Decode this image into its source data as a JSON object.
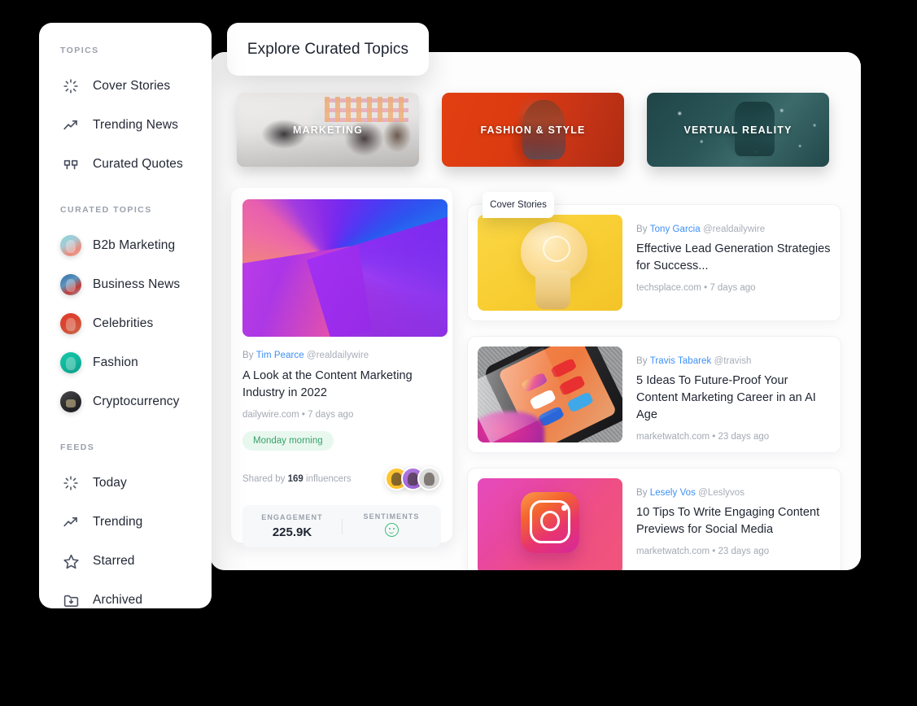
{
  "header": {
    "title": "Explore Curated Topics"
  },
  "sidebar": {
    "sections": [
      {
        "label": "TOPICS",
        "items": [
          {
            "label": "Cover Stories",
            "icon": "loading-spinner-icon"
          },
          {
            "label": "Trending News",
            "icon": "trending-up-icon"
          },
          {
            "label": "Curated Quotes",
            "icon": "quotes-icon"
          }
        ]
      },
      {
        "label": "CURATED TOPICS",
        "items": [
          {
            "label": "B2b Marketing",
            "icon": "avatar-b2b-marketing"
          },
          {
            "label": "Business News",
            "icon": "avatar-business-news"
          },
          {
            "label": "Celebrities",
            "icon": "avatar-celebrities"
          },
          {
            "label": "Fashion",
            "icon": "avatar-fashion"
          },
          {
            "label": "Cryptocurrency",
            "icon": "avatar-cryptocurrency"
          }
        ]
      },
      {
        "label": "FEEDS",
        "items": [
          {
            "label": "Today",
            "icon": "loading-spinner-icon"
          },
          {
            "label": "Trending",
            "icon": "trending-up-icon"
          },
          {
            "label": "Starred",
            "icon": "star-icon"
          },
          {
            "label": "Archived",
            "icon": "archive-folder-icon"
          }
        ]
      }
    ]
  },
  "topic_cards": [
    {
      "label": "MARKETING",
      "image": "office-team-brainstorm-photo"
    },
    {
      "label": "FASHION & STYLE",
      "image": "red-haired-model-red-background-photo"
    },
    {
      "label": "VERTUAL REALITY",
      "image": "vr-headset-teal-bokeh-photo"
    }
  ],
  "feature": {
    "image": "abstract-gradient-geometric-art",
    "by_prefix": "By",
    "author": "Tim Pearce",
    "handle": "@realdailywire",
    "title": "A Look at the Content Marketing Industry in 2022",
    "meta": "dailywire.com • 7 days ago",
    "pill": "Monday morning",
    "shared_prefix": "Shared by",
    "shared_count": "169",
    "shared_suffix": "influencers",
    "stats": [
      {
        "label": "ENGAGEMENT",
        "value": "225.9K",
        "type": "number"
      },
      {
        "label": "SENTIMENTS",
        "value": "",
        "type": "smiley-positive-icon"
      }
    ]
  },
  "cover_tab": {
    "label": "Cover Stories"
  },
  "articles": [
    {
      "thumb": "yellow-lightbulb-photo",
      "by_prefix": "By",
      "author": "Tony Garcia",
      "handle": "@realdailywire",
      "title": "Effective Lead Generation Strategies for Success...",
      "meta": "techsplace.com • 7 days ago"
    },
    {
      "thumb": "smartphone-social-media-apps-photo",
      "by_prefix": "By",
      "author": "Travis Tabarek",
      "handle": "@travish",
      "title": "5 Ideas To Future-Proof Your Content Marketing Career in an AI Age",
      "meta": "marketwatch.com • 23 days ago"
    },
    {
      "thumb": "instagram-3d-icon-photo",
      "by_prefix": "By",
      "author": "Lesely Vos",
      "handle": "@Leslyvos",
      "title": "10 Tips To Write Engaging Content Previews for Social Media",
      "meta": "marketwatch.com • 23 days ago"
    }
  ],
  "colors": {
    "accent_link": "#3e8ff5",
    "pill_bg": "#e9f8ef",
    "pill_text": "#37a169",
    "text_primary": "#1e2431",
    "text_muted": "#a3a9b4",
    "panel_bg": "#ffffff",
    "canvas_bg": "#000000"
  }
}
